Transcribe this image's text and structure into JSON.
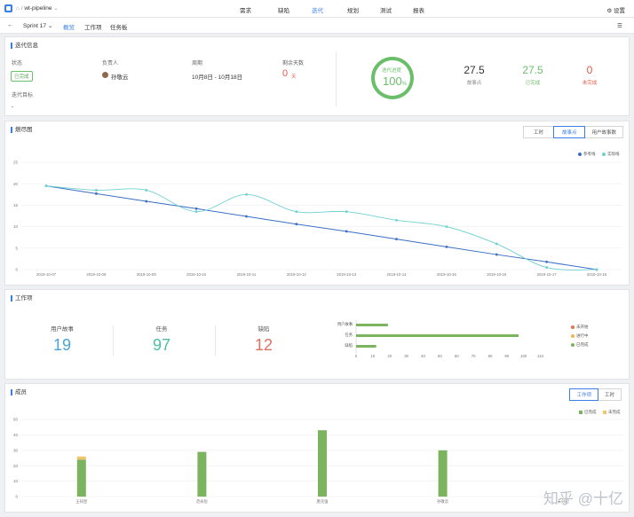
{
  "header": {
    "project_prefix": "⌂ /",
    "project_name": "wt-pipeline",
    "nav": [
      "需求",
      "缺陷",
      "迭代",
      "规划",
      "测试",
      "报表"
    ],
    "active_nav": "迭代",
    "settings_label": "设置"
  },
  "subnav": {
    "back": "←",
    "sprint": "Sprint 17",
    "tabs": [
      "概览",
      "工作项",
      "任务板"
    ],
    "active_tab": "概览"
  },
  "info": {
    "title": "迭代信息",
    "status_label": "状态",
    "status_value": "已完成",
    "owner_label": "负责人",
    "owner_value": "孙敬云",
    "period_label": "周期",
    "period_value": "10月8日 - 10月18日",
    "remaining_label": "剩余天数",
    "remaining_value": "0",
    "remaining_unit": "天",
    "goal_label": "迭代目标",
    "goal_value": "-",
    "progress_label": "迭代进度",
    "progress_value": "100",
    "progress_unit": "%",
    "progress_fraction": 1.0,
    "stats": [
      {
        "value": "27.5",
        "label": "故事点",
        "color": "#333333"
      },
      {
        "value": "27.5",
        "label": "已完成",
        "color": "#6bbf6b"
      },
      {
        "value": "0",
        "label": "未完成",
        "color": "#e05a4a"
      }
    ]
  },
  "burndown": {
    "title": "燃尽图",
    "tabs": [
      "工时",
      "故事点",
      "用户故事数"
    ],
    "active_tab": "故事点",
    "legend": [
      {
        "name": "参考线",
        "color": "#3a6fc4"
      },
      {
        "name": "实际线",
        "color": "#6fd0d0"
      }
    ]
  },
  "workitems": {
    "title": "工作项",
    "stats": [
      {
        "label": "用户故事",
        "value": "19",
        "color": "#4aa3df"
      },
      {
        "label": "任务",
        "value": "97",
        "color": "#4cc0a0"
      },
      {
        "label": "缺陷",
        "value": "12",
        "color": "#e07060"
      }
    ],
    "legend": [
      {
        "name": "未开始",
        "color": "#e8734a"
      },
      {
        "name": "进行中",
        "color": "#f2b544"
      },
      {
        "name": "已完成",
        "color": "#7bb35f"
      }
    ]
  },
  "members": {
    "title": "成员",
    "tabs": [
      "工作项",
      "工时"
    ],
    "active_tab": "工作项",
    "legend": [
      {
        "name": "已完成",
        "color": "#7bb35f"
      },
      {
        "name": "未完成",
        "color": "#f2c46a"
      }
    ]
  },
  "watermark": "知乎 @十亿",
  "chart_data": [
    {
      "type": "line",
      "title": "燃尽图",
      "x": [
        "2019-10-07",
        "2019-10-08",
        "2019-10-09",
        "2019-10-10",
        "2019-10-11",
        "2019-10-12",
        "2019-10-13",
        "2019-10-14",
        "2019-10-15",
        "2019-10-16",
        "2019-10-17",
        "2019-10-18"
      ],
      "ylim": [
        0,
        25
      ],
      "yticks": [
        0,
        5,
        10,
        15,
        20,
        25
      ],
      "series": [
        {
          "name": "参考线",
          "color": "#3a6fc4",
          "values": [
            19.5,
            17.7,
            15.9,
            14.2,
            12.4,
            10.6,
            8.9,
            7.1,
            5.3,
            3.5,
            1.8,
            0
          ]
        },
        {
          "name": "实际线",
          "color": "#6fd0d0",
          "values": [
            19.5,
            18.5,
            18.5,
            13.5,
            17.5,
            13.5,
            13.5,
            11.5,
            10,
            6,
            0.5,
            0
          ]
        }
      ],
      "grid": true,
      "legend_position": "top-right"
    },
    {
      "type": "bar",
      "orientation": "horizontal",
      "categories": [
        "用户故事",
        "任务",
        "缺陷"
      ],
      "series": [
        {
          "name": "已完成",
          "color": "#7bb35f",
          "values": [
            19,
            97,
            12
          ]
        }
      ],
      "xticks": [
        0,
        10,
        20,
        30,
        40,
        50,
        60,
        70,
        80,
        90,
        100,
        110
      ],
      "xlim": [
        0,
        115
      ],
      "legend_position": "right"
    },
    {
      "type": "bar",
      "title": "成员",
      "categories": [
        "王祥昆",
        "范永恒",
        "唐克强",
        "孙敬云",
        "未分配"
      ],
      "series": [
        {
          "name": "已完成",
          "color": "#7bb35f",
          "values": [
            24,
            29,
            43,
            30,
            0
          ]
        },
        {
          "name": "未完成",
          "color": "#f2c46a",
          "values": [
            2,
            0,
            0,
            0,
            0
          ]
        }
      ],
      "ylim": [
        0,
        50
      ],
      "yticks": [
        0,
        10,
        20,
        30,
        40,
        50
      ],
      "legend_position": "top-right"
    }
  ]
}
